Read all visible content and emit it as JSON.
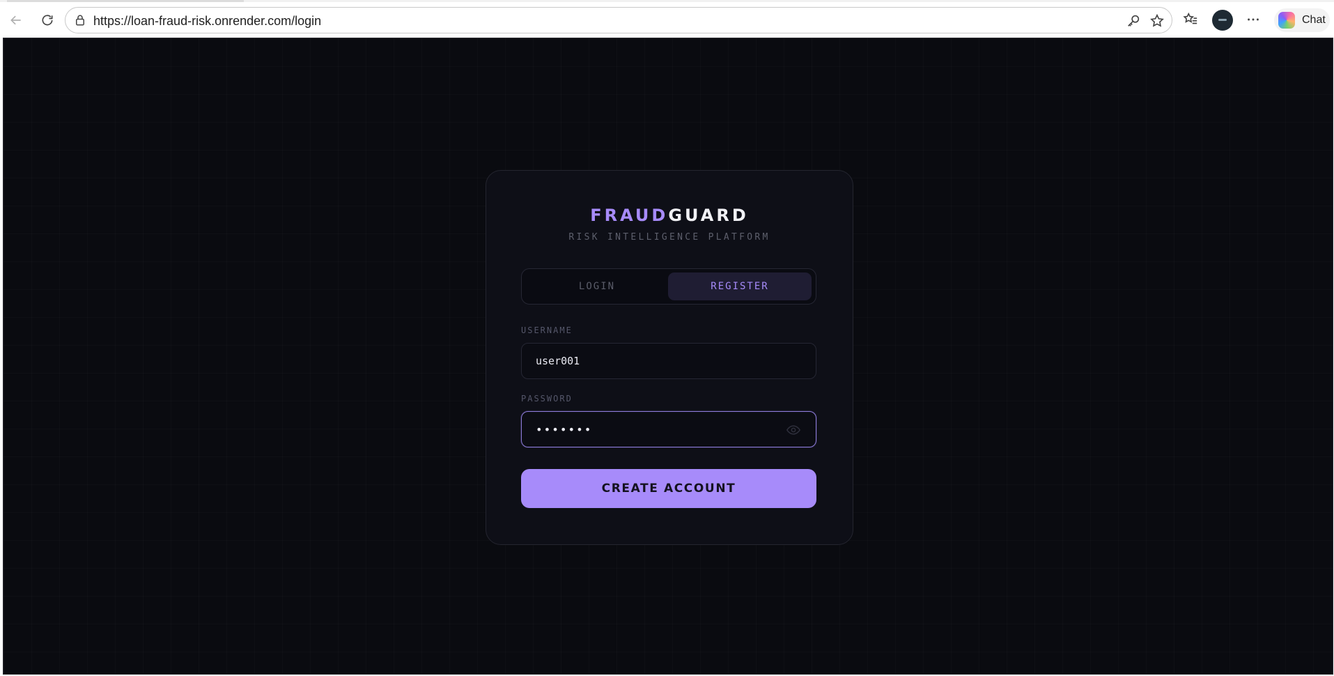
{
  "browser": {
    "url": "https://loan-fraud-risk.onrender.com/login",
    "chat_label": "Chat",
    "icons": [
      "back-icon",
      "reload-icon",
      "lock-icon",
      "key-icon",
      "star-icon",
      "favorites-icon",
      "profile-avatar",
      "more-icon",
      "copilot-icon"
    ]
  },
  "app": {
    "brand_part1": "FRAUD",
    "brand_part2": "GUARD",
    "tagline": "RISK INTELLIGENCE PLATFORM",
    "tabs": {
      "login": "LOGIN",
      "register": "REGISTER",
      "active": "register"
    },
    "form": {
      "username_label": "USERNAME",
      "username_value": "user001",
      "password_label": "PASSWORD",
      "password_value": "•••••••",
      "submit_label": "CREATE ACCOUNT"
    },
    "colors": {
      "accent": "#a78bfa",
      "background": "#0a0b10",
      "card": "#0e0f17"
    }
  }
}
